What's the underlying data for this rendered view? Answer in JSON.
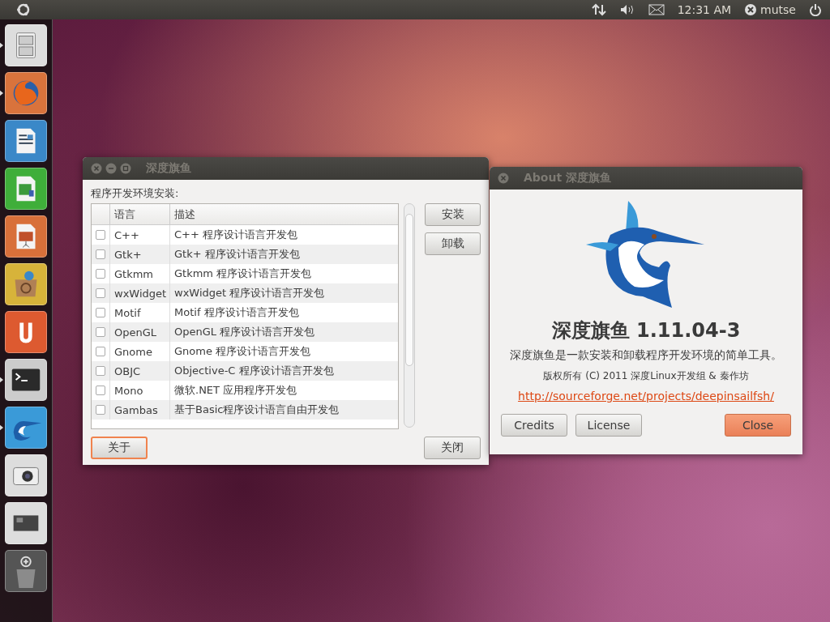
{
  "top_panel": {
    "time": "12:31 AM",
    "user": "mutse"
  },
  "launcher": [
    {
      "kind": "files",
      "running": true
    },
    {
      "kind": "browser",
      "running": true
    },
    {
      "kind": "writer",
      "running": false
    },
    {
      "kind": "calc",
      "running": false
    },
    {
      "kind": "impress",
      "running": false
    },
    {
      "kind": "software",
      "running": false
    },
    {
      "kind": "ubuntu-one",
      "running": false
    },
    {
      "kind": "terminal",
      "running": true
    },
    {
      "kind": "sailfish",
      "running": true
    },
    {
      "kind": "camera",
      "running": false
    },
    {
      "kind": "workspaces",
      "running": false
    },
    {
      "kind": "trash",
      "running": false
    }
  ],
  "main_window": {
    "title": "深度旗鱼",
    "label": "程序开发环境安装:",
    "columns": [
      "语言",
      "描述"
    ],
    "rows": [
      {
        "language": "C++",
        "description": "C++ 程序设计语言开发包",
        "checked": false
      },
      {
        "language": "Gtk+",
        "description": "Gtk+ 程序设计语言开发包",
        "checked": false
      },
      {
        "language": "Gtkmm",
        "description": "Gtkmm 程序设计语言开发包",
        "checked": false
      },
      {
        "language": "wxWidget",
        "description": "wxWidget 程序设计语言开发包",
        "checked": false
      },
      {
        "language": "Motif",
        "description": "Motif 程序设计语言开发包",
        "checked": false
      },
      {
        "language": "OpenGL",
        "description": "OpenGL 程序设计语言开发包",
        "checked": false
      },
      {
        "language": "Gnome",
        "description": "Gnome 程序设计语言开发包",
        "checked": false
      },
      {
        "language": "OBJC",
        "description": "Objective-C 程序设计语言开发包",
        "checked": false
      },
      {
        "language": "Mono",
        "description": "微软.NET 应用程序开发包",
        "checked": false
      },
      {
        "language": "Gambas",
        "description": "基于Basic程序设计语言自由开发包",
        "checked": false
      }
    ],
    "side_buttons": [
      "安装",
      "卸载"
    ],
    "bottom_buttons": [
      {
        "label": "关于",
        "focused": true
      },
      {
        "label": "关闭",
        "focused": false
      }
    ]
  },
  "about_window": {
    "title": "About 深度旗鱼",
    "app_name": "深度旗鱼 1.11.04-3",
    "description": "深度旗鱼是一款安装和卸载程序开发环境的简单工具。",
    "copyright": "版权所有 (C) 2011 深度Linux开发组 & 秦作坊",
    "link": "http://sourceforge.net/projects/deepinsailfsh/",
    "buttons": [
      {
        "label": "Credits",
        "default": false
      },
      {
        "label": "License",
        "default": false
      },
      {
        "label": "Close",
        "default": true
      }
    ]
  }
}
